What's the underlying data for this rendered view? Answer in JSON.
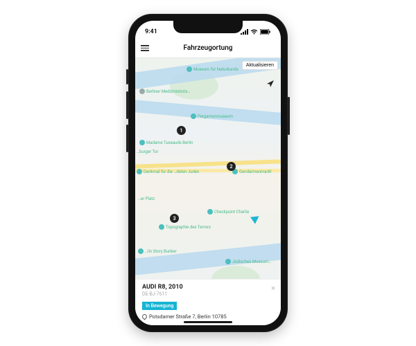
{
  "status": {
    "time": "9:41"
  },
  "nav": {
    "title": "Fahrzeugortung"
  },
  "map": {
    "refresh_label": "Aktualisieren",
    "pois": {
      "museum_naturkunde": "Museum für Naturkunde",
      "berliner_med": "Berliner Medizinistoris…",
      "pergamon": "Pergamonmuseum",
      "tussauds": "Madame Tussauds Berlin",
      "burger_tor": "…burger Tor",
      "denkmal": "Denkmal für die …deten Juden",
      "platz": "…er Platz",
      "topographie": "Topographie des Terrors",
      "story_bunker": "…lin Story Bunker",
      "checkpoint": "Checkpoint Charlie",
      "gendarmen": "Gendarmenmarkt",
      "judisches": "Jüdisches Museum…"
    },
    "markers": {
      "m1": "1",
      "m2": "2",
      "m3": "3"
    }
  },
  "card": {
    "vehicle_title": "AUDI R8, 2010",
    "vehicle_sub": "DE-BJ-7611",
    "status_badge": "In Bewegung",
    "address": "Potsdamer Straße 7, Berlin 10785"
  }
}
